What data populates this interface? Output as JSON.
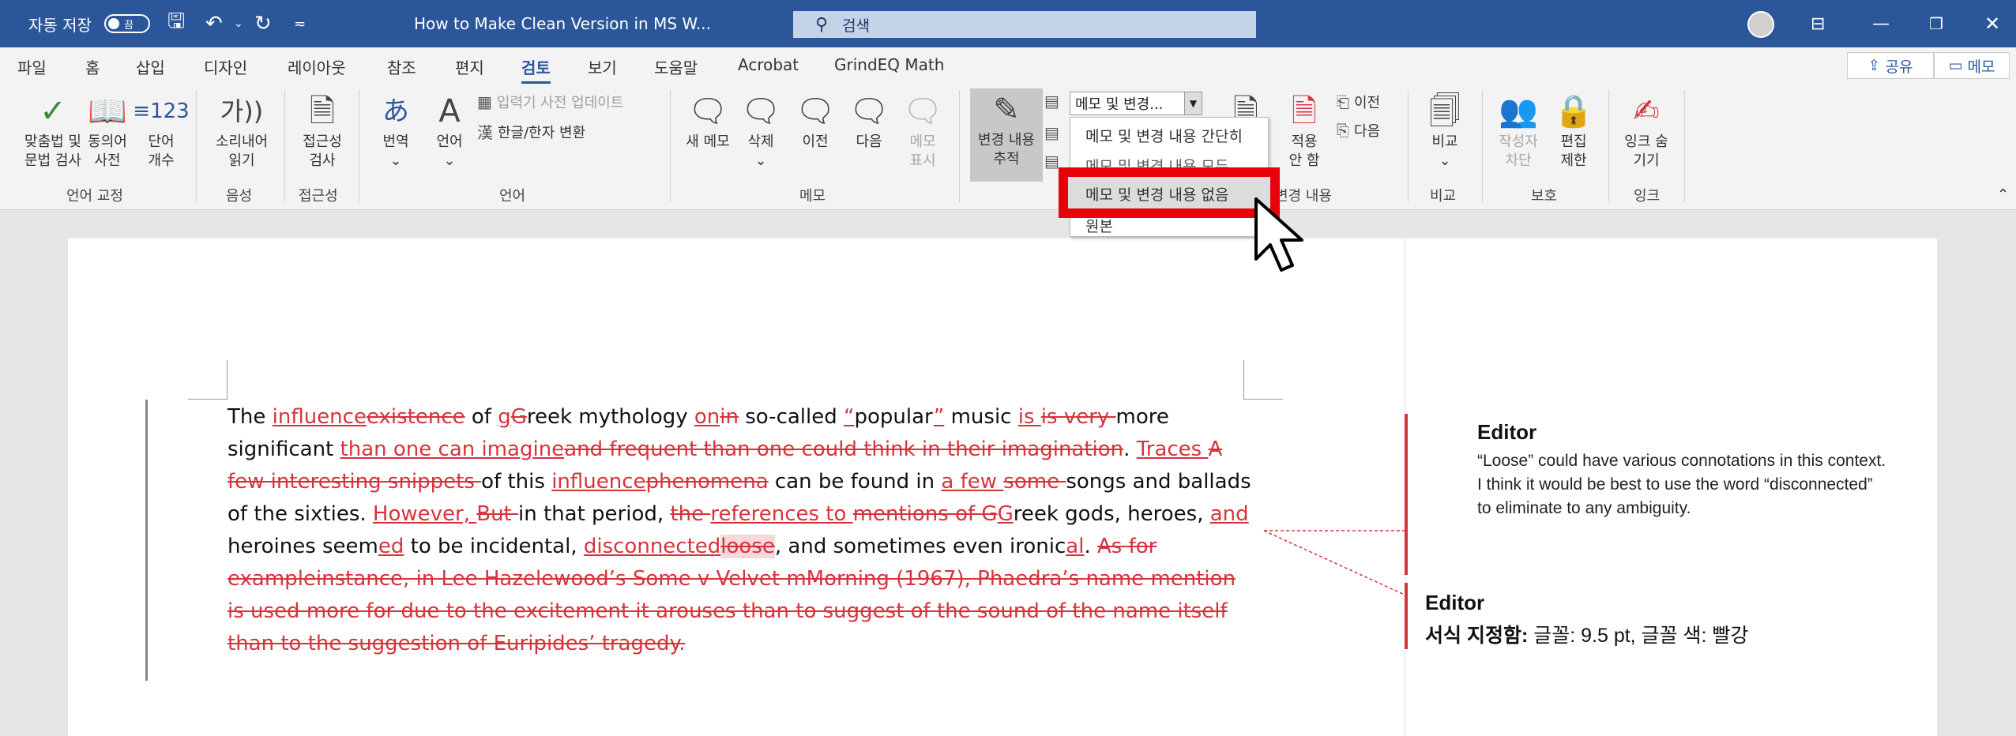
{
  "titlebar": {
    "autosave_label": "자동 저장",
    "autosave_state": "끔",
    "doc_title": "How to Make Clean Version in MS W...",
    "search_placeholder": "검색",
    "icons": [
      "save-icon",
      "undo-icon",
      "redo-icon",
      "user-avatar-icon",
      "ribbon-display-icon",
      "minimize-icon",
      "restore-icon",
      "close-icon"
    ]
  },
  "tabs": [
    "파일",
    "홈",
    "삽입",
    "디자인",
    "레이아웃",
    "참조",
    "편지",
    "검토",
    "보기",
    "도움말",
    "Acrobat",
    "GrindEQ Math"
  ],
  "active_tab": "검토",
  "share_label": "공유",
  "comments_label": "메모",
  "ribbon": {
    "proofing": {
      "spelling": [
        "맞춤법 및",
        "문법 검사"
      ],
      "thesaurus": [
        "동의어",
        "사전"
      ],
      "wordcount": [
        "단어",
        "개수"
      ],
      "label": "언어 교정"
    },
    "speech": {
      "read_aloud": [
        "소리내어",
        "읽기"
      ],
      "label": "음성"
    },
    "accessibility": {
      "check": [
        "접근성",
        "검사"
      ],
      "label": "접근성"
    },
    "language": {
      "translate": "번역",
      "language": "언어",
      "ime_dictionary": "입력기 사전 업데이트",
      "hanja": "한글/한자 변환",
      "label": "언어"
    },
    "comments": {
      "new": "새 메모",
      "delete": "삭제",
      "previous": "이전",
      "next": "다음",
      "show": [
        "메모",
        "표시"
      ],
      "label": "메모"
    },
    "tracking": {
      "track_changes": [
        "변경 내용",
        "추적"
      ],
      "markup_value": "메모 및 변경...",
      "label": "변경 내용"
    },
    "changes": {
      "accept": [
        "적용",
        "안 함"
      ],
      "previous": "이전",
      "next": "다음"
    },
    "compare": {
      "compare": "비교",
      "label": "비교"
    },
    "protect": {
      "block_authors": [
        "작성자",
        "차단"
      ],
      "restrict_editing": [
        "편집",
        "제한"
      ],
      "label": "보호"
    },
    "ink": {
      "hide_ink": [
        "잉크 숨",
        "기기"
      ],
      "label": "잉크"
    }
  },
  "markup_dropdown": {
    "items": [
      "메모 및 변경 내용 간단히",
      "메모 및 변경 내용 모두",
      "메모 및 변경 내용 없음",
      "원본"
    ],
    "selected_index": 2
  },
  "document": {
    "segments": [
      {
        "t": "n",
        "s": "The "
      },
      {
        "t": "i",
        "s": "influence"
      },
      {
        "t": "d",
        "s": "existence"
      },
      {
        "t": "n",
        "s": " of "
      },
      {
        "t": "i",
        "s": "g"
      },
      {
        "t": "d",
        "s": "G"
      },
      {
        "t": "n",
        "s": "reek mythology "
      },
      {
        "t": "i",
        "s": "on"
      },
      {
        "t": "d",
        "s": "in"
      },
      {
        "t": "n",
        "s": " so-called "
      },
      {
        "t": "i",
        "s": "“"
      },
      {
        "t": "n",
        "s": "popular"
      },
      {
        "t": "i",
        "s": "”"
      },
      {
        "t": "n",
        "s": " music "
      },
      {
        "t": "i",
        "s": "is "
      },
      {
        "t": "d",
        "s": "is very "
      },
      {
        "t": "n",
        "s": "more significant "
      },
      {
        "t": "i",
        "s": "than one can imagine"
      },
      {
        "t": "d",
        "s": "and frequent than one could think in their imagination"
      },
      {
        "t": "n",
        "s": ". "
      },
      {
        "t": "i",
        "s": "Traces "
      },
      {
        "t": "d",
        "s": "A few interesting snippets "
      },
      {
        "t": "n",
        "s": "of this "
      },
      {
        "t": "i",
        "s": "influence"
      },
      {
        "t": "d",
        "s": "phenomena"
      },
      {
        "t": "n",
        "s": " can be found in "
      },
      {
        "t": "i",
        "s": "a few "
      },
      {
        "t": "d",
        "s": "some "
      },
      {
        "t": "n",
        "s": "songs and ballads of the sixties. "
      },
      {
        "t": "i",
        "s": "However, "
      },
      {
        "t": "d",
        "s": "But "
      },
      {
        "t": "n",
        "s": "in that period, "
      },
      {
        "t": "d",
        "s": "the "
      },
      {
        "t": "i",
        "s": "references to "
      },
      {
        "t": "d",
        "s": "mentions of "
      },
      {
        "t": "d",
        "s": "G"
      },
      {
        "t": "i",
        "s": "G"
      },
      {
        "t": "n",
        "s": "reek gods, heroes, "
      },
      {
        "t": "i",
        "s": "and"
      },
      {
        "t": "n",
        "s": " heroines seem"
      },
      {
        "t": "i",
        "s": "ed"
      },
      {
        "t": "n",
        "s": " to be incidental, "
      },
      {
        "t": "i",
        "s": "disconnected"
      },
      {
        "t": "h",
        "s": "loose"
      },
      {
        "t": "n",
        "s": ", and sometimes even ironic"
      },
      {
        "t": "i",
        "s": "al"
      },
      {
        "t": "n",
        "s": ". "
      },
      {
        "t": "d",
        "s": "As for exampleinstance, in Lee Hazelewood’s Some v Velvet mMorning (1967), Phaedra’s name mention is used more for due to the excitement it arouses than to suggest of the sound of the name itself than to the suggestion of Euripides’ tragedy."
      }
    ]
  },
  "comments": [
    {
      "author": "Editor",
      "text": "“Loose” could have various connotations in this context. I think it would be best to use the word “disconnected” to eliminate to any ambiguity."
    },
    {
      "author": "Editor",
      "format_label": "서식 지정함:",
      "format_value": " 글꼴: 9.5 pt, 글꼴 색: 빨강"
    }
  ],
  "colors": {
    "titlebar": "#2b579a",
    "revision": "#d6343c",
    "highlight_box": "#e8000b"
  }
}
